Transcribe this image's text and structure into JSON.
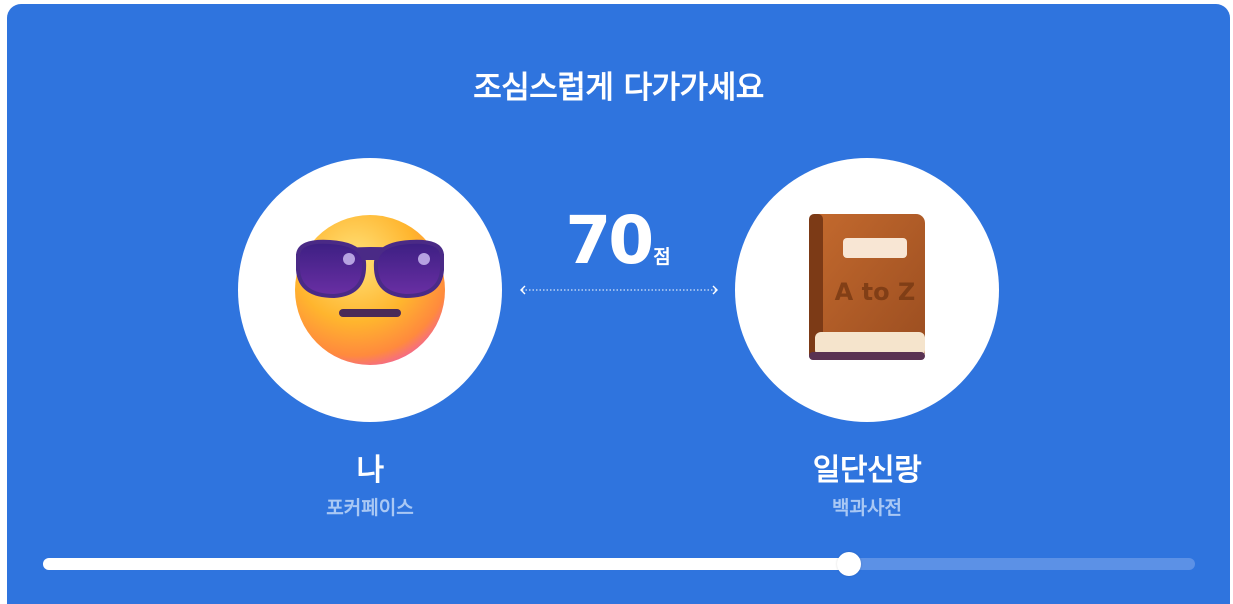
{
  "header": {
    "title": "조심스럽게 다가가세요"
  },
  "me": {
    "name": "나",
    "subtitle": "포커페이스",
    "icon": "sunglasses-face-icon"
  },
  "partner": {
    "name": "일단신랑",
    "subtitle": "백과사전",
    "icon": "dictionary-book-icon",
    "book_label": "A to Z"
  },
  "score": {
    "value": "70",
    "unit": "점"
  },
  "progress": {
    "percent": 70
  },
  "colors": {
    "background": "#2f74de",
    "track": "#5c91e6",
    "fill": "#ffffff",
    "subtitle": "#a9c8f4"
  }
}
